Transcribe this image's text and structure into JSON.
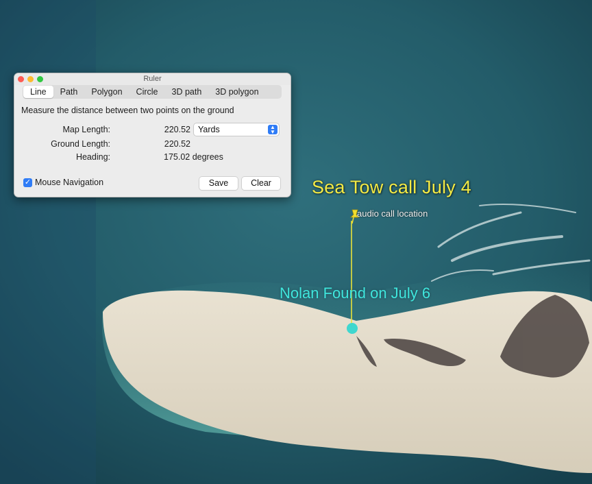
{
  "ruler": {
    "title": "Ruler",
    "tabs": [
      "Line",
      "Path",
      "Polygon",
      "Circle",
      "3D path",
      "3D polygon"
    ],
    "active_tab": "Line",
    "description": "Measure the distance between two points on the ground",
    "map_length_label": "Map Length:",
    "map_length_value": "220.52",
    "unit_selected": "Yards",
    "ground_length_label": "Ground Length:",
    "ground_length_value": "220.52",
    "heading_label": "Heading:",
    "heading_value": "175.02 degrees",
    "mouse_navigation_label": "Mouse Navigation",
    "mouse_navigation_checked": true,
    "save_label": "Save",
    "clear_label": "Clear"
  },
  "map": {
    "sea_tow_label": "Sea Tow call July 4",
    "placemark_label": "audio call location",
    "placemark_icon": "pushpin-icon",
    "found_label": "Nolan Found on July 6",
    "endpoint_icon": "circle-marker-icon",
    "colors": {
      "ruler_line": "#e8e23a",
      "sea_tow_text": "#f3ea45",
      "found_text": "#3fe6dd",
      "found_marker": "#36d6cf"
    }
  }
}
